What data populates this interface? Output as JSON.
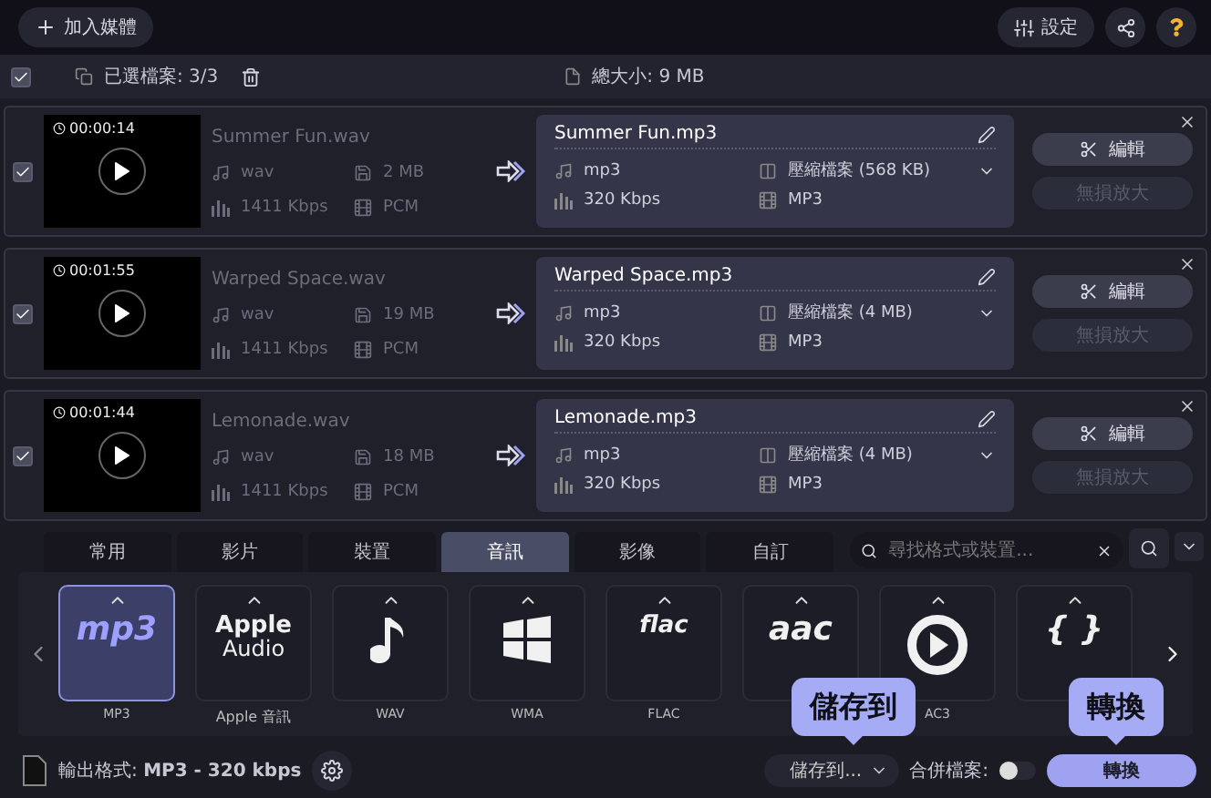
{
  "toolbar": {
    "add_button": "加入媒體",
    "settings_button": "設定"
  },
  "selection_bar": {
    "all_checked": true,
    "selected_label": "已選檔案: 3/3",
    "total_size": "總大小: 9 MB"
  },
  "files": [
    {
      "checked": true,
      "duration": "00:00:14",
      "source": {
        "name": "Summer Fun.wav",
        "format": "wav",
        "size": "2 MB",
        "bitrate": "1411 Kbps",
        "codec": "PCM"
      },
      "output": {
        "name": "Summer Fun.mp3",
        "format": "mp3",
        "compression": "壓縮檔案 (568 KB)",
        "bitrate": "320 Kbps",
        "codec": "MP3"
      },
      "edit_button": "編輯",
      "upscale_button": {
        "label": "無損放大",
        "disabled": true
      }
    },
    {
      "checked": true,
      "duration": "00:01:55",
      "source": {
        "name": "Warped Space.wav",
        "format": "wav",
        "size": "19 MB",
        "bitrate": "1411 Kbps",
        "codec": "PCM"
      },
      "output": {
        "name": "Warped Space.mp3",
        "format": "mp3",
        "compression": "壓縮檔案 (4 MB)",
        "bitrate": "320 Kbps",
        "codec": "MP3"
      },
      "edit_button": "編輯",
      "upscale_button": {
        "label": "無損放大",
        "disabled": true
      }
    },
    {
      "checked": true,
      "duration": "00:01:44",
      "source": {
        "name": "Lemonade.wav",
        "format": "wav",
        "size": "18 MB",
        "bitrate": "1411 Kbps",
        "codec": "PCM"
      },
      "output": {
        "name": "Lemonade.mp3",
        "format": "mp3",
        "compression": "壓縮檔案 (4 MB)",
        "bitrate": "320 Kbps",
        "codec": "MP3"
      },
      "edit_button": "編輯",
      "upscale_button": {
        "label": "無損放大",
        "disabled": true
      }
    }
  ],
  "format_tabs": [
    {
      "label": "常用",
      "selected": false
    },
    {
      "label": "影片",
      "selected": false
    },
    {
      "label": "裝置",
      "selected": false
    },
    {
      "label": "音訊",
      "selected": true
    },
    {
      "label": "影像",
      "selected": false
    },
    {
      "label": "自訂",
      "selected": false
    }
  ],
  "search": {
    "placeholder": "尋找格式或裝置..."
  },
  "formats": [
    {
      "kind": "text",
      "logo": "mp3",
      "label": "MP3",
      "selected": true
    },
    {
      "kind": "two-line",
      "logo": "Apple",
      "logo_sub": "Audio",
      "label": "Apple 音訊",
      "selected": false
    },
    {
      "kind": "note",
      "label": "WAV",
      "selected": false
    },
    {
      "kind": "windows",
      "label": "WMA",
      "selected": false
    },
    {
      "kind": "text",
      "logo": "flac",
      "label": "FLAC",
      "selected": false
    },
    {
      "kind": "text",
      "logo": "aac",
      "selected": false
    },
    {
      "kind": "play",
      "label": "AC3",
      "selected": false
    },
    {
      "kind": "text",
      "logo": "{ }",
      "selected": false
    }
  ],
  "bottom": {
    "output_label": "輸出格式:",
    "output_value": "MP3 - 320 kbps",
    "save_button": "儲存到...",
    "merge_label": "合併檔案:",
    "merge_on": false,
    "convert_button": "轉換"
  },
  "callouts": [
    {
      "kind": "save",
      "text": "儲存到"
    },
    {
      "kind": "convert",
      "text": "轉換"
    }
  ]
}
